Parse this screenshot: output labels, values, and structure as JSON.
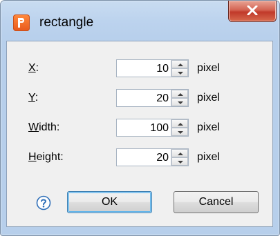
{
  "window": {
    "title": "rectangle",
    "app_icon": "app-logo-icon",
    "close_icon": "close-icon"
  },
  "form": {
    "rows": [
      {
        "mnemonic": "X",
        "rest": ":",
        "value": "10",
        "unit": "pixel"
      },
      {
        "mnemonic": "Y",
        "rest": ":",
        "value": "20",
        "unit": "pixel"
      },
      {
        "mnemonic": "W",
        "rest": "idth:",
        "value": "100",
        "unit": "pixel"
      },
      {
        "mnemonic": "H",
        "rest": "eight:",
        "value": "20",
        "unit": "pixel"
      }
    ]
  },
  "footer": {
    "help_icon": "help-icon",
    "ok_label": "OK",
    "cancel_label": "Cancel"
  }
}
